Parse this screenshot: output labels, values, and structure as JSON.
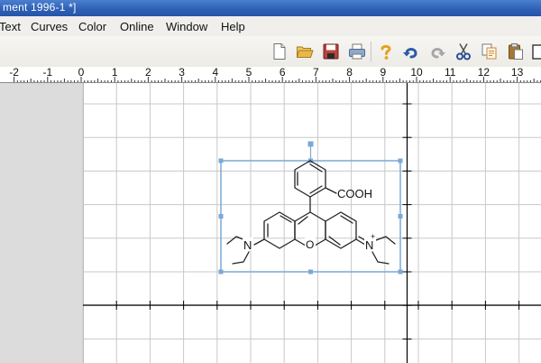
{
  "window": {
    "title": "ment 1996-1 *]"
  },
  "menu": {
    "items": [
      {
        "id": "text",
        "label": "Text"
      },
      {
        "id": "curves",
        "label": "Curves"
      },
      {
        "id": "color",
        "label": "Color"
      },
      {
        "id": "online",
        "label": "Online"
      },
      {
        "id": "window",
        "label": "Window"
      },
      {
        "id": "help",
        "label": "Help"
      }
    ]
  },
  "toolbar": {
    "buttons": [
      {
        "icon": "new-document-icon",
        "color": "#ffffff"
      },
      {
        "icon": "open-folder-icon",
        "color": "#e8b84a"
      },
      {
        "icon": "save-icon",
        "color": "#b8443c"
      },
      {
        "icon": "print-icon",
        "color": "#6f8fb3"
      },
      {
        "icon": "help-icon",
        "color": "#e6a21e"
      },
      {
        "icon": "undo-icon",
        "color": "#2b5aa8"
      },
      {
        "icon": "redo-icon",
        "color": "#9a9a9a"
      },
      {
        "icon": "cut-icon",
        "color": "#2b4f9a"
      },
      {
        "icon": "copy-icon",
        "color": "#c8873a"
      },
      {
        "icon": "paste-icon",
        "color": "#a9782e"
      }
    ]
  },
  "ruler": {
    "labels": [
      "-2",
      "-1",
      "0",
      "1",
      "2",
      "3",
      "4",
      "5",
      "6",
      "7",
      "8",
      "9",
      "10",
      "11",
      "12",
      "13"
    ]
  },
  "molecule": {
    "labels": {
      "acid": "COOH",
      "amine_left": "N",
      "amine_right": "N",
      "ring_oxygen": "O",
      "iminium_charge": "+"
    }
  },
  "colors": {
    "grid": "#c8c8c8",
    "axis": "#000000",
    "selection": "#7aa9d6",
    "panel": "#dcdcdc",
    "title_bar": "#2d5fb4"
  }
}
